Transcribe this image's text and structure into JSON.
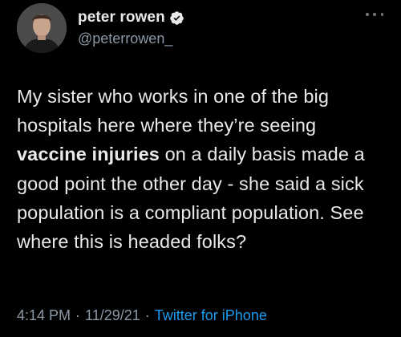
{
  "author": {
    "display_name": "peter rowen",
    "handle": "@peterrowen_",
    "verified": true
  },
  "tweet": {
    "text_before": "My sister who works in one of the big hospitals here where they’re seeing ",
    "text_bold": "vaccine injuries",
    "text_after": " on a daily basis made a good point the other day - she said a sick population is a compliant population. See where this is headed folks?"
  },
  "meta": {
    "time": "4:14 PM",
    "separator": "·",
    "date": "11/29/21",
    "source": "Twitter for iPhone"
  },
  "colors": {
    "background": "#000000",
    "text": "#e7e9ea",
    "secondary": "#8b98a5",
    "link": "#1d9bf0",
    "verified_badge": "#1d9bf0"
  },
  "icons": {
    "verified": "verified-badge-icon",
    "more": "more-options-icon"
  }
}
